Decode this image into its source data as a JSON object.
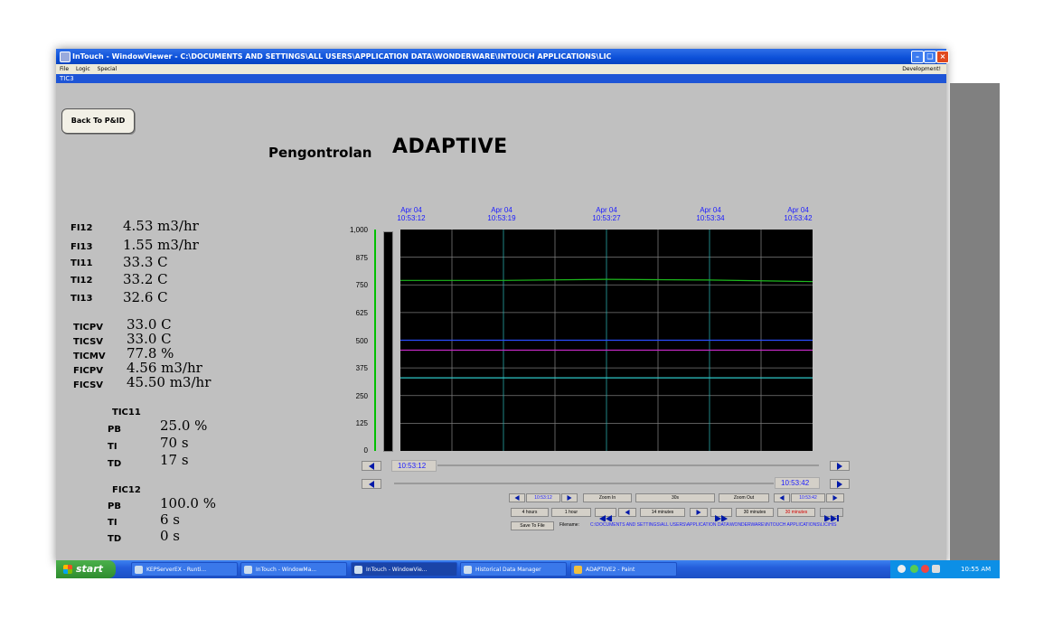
{
  "window": {
    "title": "InTouch - WindowViewer - C:\\DOCUMENTS AND SETTINGS\\ALL USERS\\APPLICATION DATA\\WONDERWARE\\INTOUCH APPLICATIONS\\LIC",
    "menu": [
      "File",
      "Logic",
      "Special"
    ],
    "development": "Development!",
    "subtitle": "TIC3"
  },
  "back_button": "Back To P&ID",
  "heading": {
    "prefix": "Pengontrolan",
    "mode": "ADAPTIVE"
  },
  "readings": [
    {
      "tag": "FI12",
      "value": "4.53 m3/hr"
    },
    {
      "tag": "FI13",
      "value": "1.55 m3/hr"
    },
    {
      "tag": "TI11",
      "value": "33.3 C"
    },
    {
      "tag": "TI12",
      "value": "33.2 C"
    },
    {
      "tag": "TI13",
      "value": "32.6 C"
    },
    {
      "tag": "TICPV",
      "value": "33.0 C"
    },
    {
      "tag": "TICSV",
      "value": "33.0 C"
    },
    {
      "tag": "TICMV",
      "value": "77.8 %"
    },
    {
      "tag": "FICPV",
      "value": "4.56 m3/hr"
    },
    {
      "tag": "FICSV",
      "value": "45.50 m3/hr"
    }
  ],
  "tic11": {
    "title": "TIC11",
    "params": [
      {
        "tag": "PB",
        "value": "25.0 %"
      },
      {
        "tag": "TI",
        "value": "70 s"
      },
      {
        "tag": "TD",
        "value": "17 s"
      }
    ]
  },
  "fic12": {
    "title": "FIC12",
    "params": [
      {
        "tag": "PB",
        "value": "100.0 %"
      },
      {
        "tag": "TI",
        "value": "6 s"
      },
      {
        "tag": "TD",
        "value": "0 s"
      }
    ]
  },
  "trend": {
    "time_labels": [
      {
        "date": "Apr 04",
        "time": "10:53:12"
      },
      {
        "date": "Apr 04",
        "time": "10:53:19"
      },
      {
        "date": "Apr 04",
        "time": "10:53:27"
      },
      {
        "date": "Apr 04",
        "time": "10:53:34"
      },
      {
        "date": "Apr 04",
        "time": "10:53:42"
      }
    ],
    "y_ticks": [
      "1,000",
      "875",
      "750",
      "625",
      "500",
      "375",
      "250",
      "125",
      "0"
    ],
    "start_time": "10:53:12",
    "end_time": "10:53:42",
    "controls": {
      "left_time": "10:53:12",
      "zoom_in": "Zoom In",
      "span": "30s",
      "zoom_out": "Zoom Out",
      "right_time": "10:53:42",
      "ranges_left": [
        "4 hours",
        "1 hour"
      ],
      "minutes_mid": "14 minutes",
      "ranges_right": [
        "30 minutes"
      ],
      "ranges_red": "30 minutes",
      "save": "Save To File",
      "filename_label": "Filename:",
      "filename": "C:\\DOCUMENTS AND SETTINGS\\ALL USERS\\APPLICATION DATA\\WONDERWARE\\INTOUCH APPLICATIONS\\LIC\\HIS"
    }
  },
  "chart_data": {
    "type": "line",
    "x": [
      "10:53:12",
      "10:53:19",
      "10:53:27",
      "10:53:34",
      "10:53:42"
    ],
    "ylim": [
      0,
      1000
    ],
    "grid": true,
    "series": [
      {
        "values": [
          770,
          770,
          775,
          772,
          765
        ],
        "color": "#1db81d"
      },
      {
        "values": [
          500,
          500,
          500,
          500,
          500
        ],
        "color": "#2a4dff"
      },
      {
        "values": [
          455,
          455,
          455,
          455,
          455
        ],
        "color": "#c42ac4"
      },
      {
        "values": [
          330,
          330,
          330,
          330,
          330
        ],
        "color": "#2ec7c7"
      }
    ]
  },
  "taskbar": {
    "start": "start",
    "items": [
      "KEPServerEX - Runti...",
      "InTouch - WindowMa...",
      "InTouch - WindowVie...",
      "Historical Data Manager",
      "ADAPTIVE2 - Paint"
    ],
    "clock": "10:55 AM"
  }
}
